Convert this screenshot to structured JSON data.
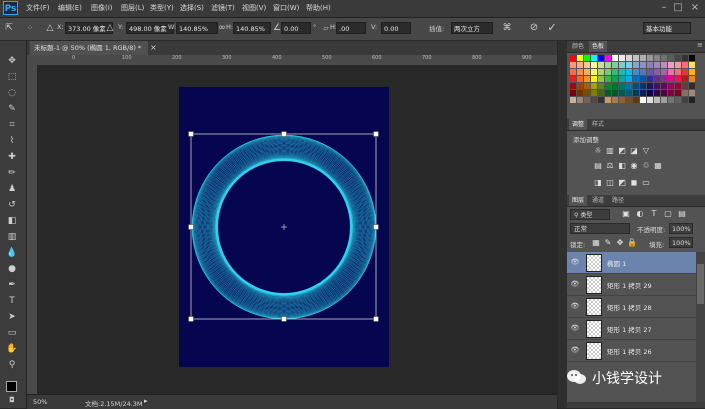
{
  "app": {
    "logo": "Ps"
  },
  "menu": [
    "文件(F)",
    "编辑(E)",
    "图像(I)",
    "图层(L)",
    "类型(Y)",
    "选择(S)",
    "滤镜(T)",
    "视图(V)",
    "窗口(W)",
    "帮助(H)"
  ],
  "options": {
    "x_label": "X:",
    "x_value": "373.00 像素",
    "y_label": "Y:",
    "y_value": "498.00 像素",
    "w_label": "W:",
    "w_value": "140.85%",
    "h_label": "H:",
    "h_value": "140.85%",
    "angle_value": "0.00",
    "hskew_label": "H:",
    "hskew_value": ".00",
    "vskew_label": "V:",
    "vskew_value": "0.00",
    "interp_label": "插值:",
    "interp_value": "两次立方",
    "workspace": "基本功能"
  },
  "document": {
    "tab_title": "未标题-1 @ 50% (椭圆 1, RGB/8) *",
    "zoom": "50%",
    "doc_info": "文档:2.15M/24.3M"
  },
  "ruler_h": [
    "",
    "0",
    "",
    "100",
    "",
    "200",
    "",
    "300",
    "",
    "400",
    "",
    "500",
    "",
    "600",
    "",
    "700",
    "",
    "800",
    "",
    "900"
  ],
  "panels": {
    "color_tabs": [
      "颜色",
      "色板"
    ],
    "adjust_tabs": [
      "调整",
      "样式"
    ],
    "adjust_heading": "添加调整",
    "layers_tabs": [
      "图层",
      "通道",
      "路径"
    ],
    "filter_label": "类型",
    "blend_mode": "正常",
    "opacity_label": "不透明度:",
    "opacity_value": "100%",
    "lock_label": "锁定:",
    "fill_label": "填充:",
    "fill_value": "100%"
  },
  "layers": [
    {
      "name": "椭圆 1",
      "selected": true
    },
    {
      "name": "矩形 1 拷贝 29",
      "selected": false
    },
    {
      "name": "矩形 1 拷贝 28",
      "selected": false
    },
    {
      "name": "矩形 1 拷贝 27",
      "selected": false
    },
    {
      "name": "矩形 1 拷贝 26",
      "selected": false
    }
  ],
  "watermark": "小钱学设计",
  "colors": {
    "canvas_bg": "#050550",
    "ring": "#2fe0f0",
    "selection": "#6a84ad"
  }
}
